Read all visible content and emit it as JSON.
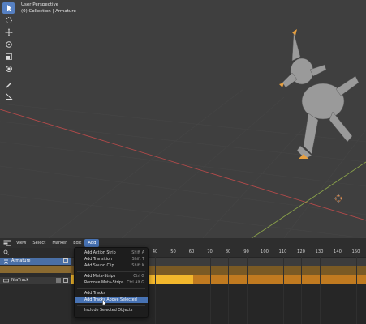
{
  "viewport": {
    "title": "User Perspective",
    "subtitle": "(0) Collection | Armature",
    "tools": [
      {
        "name": "select-icon",
        "active": true
      },
      {
        "name": "cursor-icon",
        "active": false
      },
      {
        "name": "move-icon",
        "active": false
      },
      {
        "name": "rotate-icon",
        "active": false
      },
      {
        "name": "scale-icon",
        "active": false
      },
      {
        "name": "transform-icon",
        "active": false
      },
      {
        "name": "annotate-icon",
        "active": false
      },
      {
        "name": "measure-icon",
        "active": false
      }
    ]
  },
  "nla": {
    "menu_view": "View",
    "menu_select": "Select",
    "menu_marker": "Marker",
    "menu_edit": "Edit",
    "menu_add": "Add",
    "channels": {
      "armature": "Armature",
      "action": "",
      "track": "NlaTrack"
    },
    "ruler_ticks": [
      "40",
      "50",
      "60",
      "70",
      "80",
      "90",
      "100",
      "110",
      "120",
      "130",
      "140",
      "150"
    ]
  },
  "add_menu": {
    "items": [
      {
        "label": "Add Action Strip",
        "shortcut": "Shift A"
      },
      {
        "label": "Add Transition",
        "shortcut": "Shift T"
      },
      {
        "label": "Add Sound Clip",
        "shortcut": "Shift K"
      },
      {
        "label": "Add Meta-Strips",
        "shortcut": "Ctrl G"
      },
      {
        "label": "Remove Meta-Strips",
        "shortcut": "Ctrl Alt G"
      },
      {
        "label": "Add Tracks",
        "shortcut": ""
      },
      {
        "label": "Add Tracks Above Selected",
        "shortcut": ""
      },
      {
        "label": "Include Selected Objects",
        "shortcut": ""
      }
    ]
  },
  "colors": {
    "accent": "#4772b3",
    "strip": "#f2b72c",
    "track": "#c07a20"
  }
}
